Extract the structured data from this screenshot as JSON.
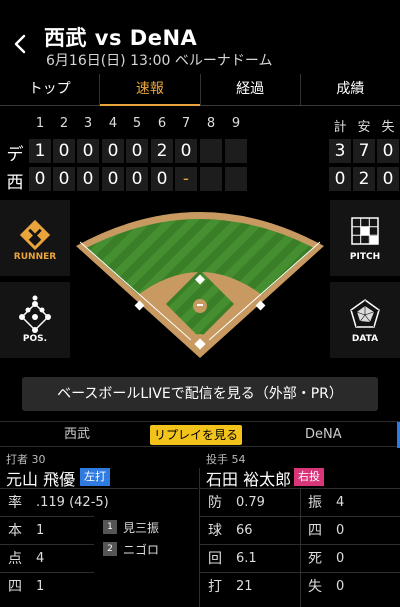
{
  "header": {
    "title": "西武 vs DeNA",
    "subtitle": "6月16日(日) 13:00 ベルーナドーム"
  },
  "tabs": [
    {
      "label": "トップ"
    },
    {
      "label": "速報"
    },
    {
      "label": "経過"
    },
    {
      "label": "成績"
    }
  ],
  "scoreboard": {
    "innings": [
      "1",
      "2",
      "3",
      "4",
      "5",
      "6",
      "7",
      "8",
      "9"
    ],
    "totals_header": [
      "計",
      "安",
      "失"
    ],
    "teams": [
      {
        "abbr": "デ",
        "scores": [
          "1",
          "0",
          "0",
          "0",
          "0",
          "2",
          "0",
          "",
          ""
        ],
        "totals": [
          "3",
          "7",
          "0"
        ]
      },
      {
        "abbr": "西",
        "scores": [
          "0",
          "0",
          "0",
          "0",
          "0",
          "0",
          "-",
          "",
          ""
        ],
        "totals": [
          "0",
          "2",
          "0"
        ]
      }
    ]
  },
  "side_buttons": {
    "runner": "RUNNER",
    "pitch": "PITCH",
    "pos": "POS.",
    "data": "DATA"
  },
  "live_button": "ベースボールLIVEで配信を見る（外部・PR）",
  "replay_bar": {
    "left_team": "西武",
    "replay": "リプレイを見る",
    "right_team": "DeNA"
  },
  "batter": {
    "role_label": "打者 30",
    "name": "元山 飛優",
    "bat_side": "左打",
    "stats": [
      {
        "key": "率",
        "value": ".119 (42-5)"
      },
      {
        "key": "本",
        "value": "1"
      },
      {
        "key": "点",
        "value": "4"
      },
      {
        "key": "四",
        "value": "1"
      }
    ],
    "plate_appearances": [
      {
        "num": "1",
        "result": "見三振"
      },
      {
        "num": "2",
        "result": "ニゴロ"
      }
    ]
  },
  "pitcher": {
    "role_label": "投手 54",
    "name": "石田 裕太郎",
    "throw_side": "右投",
    "stats_left": [
      {
        "key": "防",
        "value": "0.79"
      },
      {
        "key": "球",
        "value": "66"
      },
      {
        "key": "回",
        "value": "6.1"
      },
      {
        "key": "打",
        "value": "21"
      }
    ],
    "stats_right": [
      {
        "key": "振",
        "value": "4"
      },
      {
        "key": "四",
        "value": "0"
      },
      {
        "key": "死",
        "value": "0"
      },
      {
        "key": "失",
        "value": "0"
      }
    ]
  },
  "colors": {
    "accent": "#e9a43c",
    "replay_yellow": "#f2c31a",
    "bat_badge": "#2f7be0",
    "throw_badge": "#d9367a",
    "grass": "#3f8a2c",
    "dirt": "#c89a62"
  }
}
